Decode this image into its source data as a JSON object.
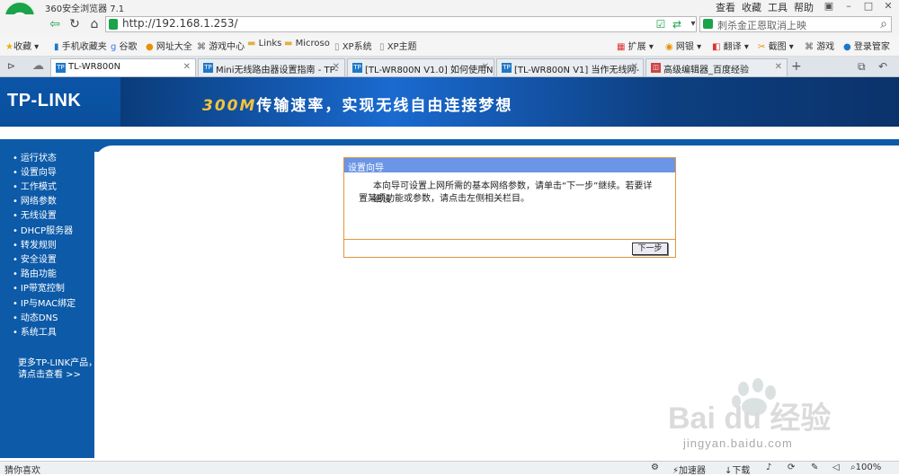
{
  "window": {
    "title": "360安全浏览器 7.1",
    "menu": [
      "查看",
      "收藏",
      "工具",
      "帮助"
    ]
  },
  "addressbar": {
    "url": "http://192.168.1.253/",
    "search_placeholder": "刺杀金正恩取消上映"
  },
  "bookmarks": [
    "收藏",
    "手机收藏夹",
    "谷歌",
    "网址大全",
    "游戏中心",
    "Links",
    "Microso",
    "XP系统",
    "XP主题"
  ],
  "toolbar_right": [
    "扩展",
    "网银",
    "翻译",
    "截图",
    "游戏",
    "登录管家"
  ],
  "tabs": [
    {
      "label": "TL-WR800N",
      "active": true
    },
    {
      "label": "Mini无线路由器设置指南 - TP-",
      "active": false
    },
    {
      "label": "[TL-WR800N V1.0] 如何使用N",
      "active": false
    },
    {
      "label": "[TL-WR800N V1] 当作无线网-",
      "active": false
    },
    {
      "label": "高级编辑器_百度经验",
      "active": false
    }
  ],
  "banner": {
    "brand": "TP-LINK",
    "slogan_em": "300M",
    "slogan_rest": "传输速率，实现无线自由连接梦想"
  },
  "leftnav": {
    "items": [
      "运行状态",
      "设置向导",
      "工作模式",
      "网络参数",
      "无线设置",
      "DHCP服务器",
      "转发规则",
      "安全设置",
      "路由功能",
      "IP带宽控制",
      "IP与MAC绑定",
      "动态DNS",
      "系统工具"
    ],
    "more_line1": "更多TP-LINK产品，",
    "more_line2": "请点击查看 >>"
  },
  "dialog": {
    "title": "设置向导",
    "text_line1": "本向导可设置上网所需的基本网络参数，请单击“下一步”继续。若要详细设",
    "text_line2": "置某项功能或参数，请点击左侧相关栏目。",
    "next_label": "下一步"
  },
  "statusbar": {
    "left": "猜你喜欢",
    "accelerator": "加速器",
    "download": "下载",
    "zoom": "100%"
  },
  "watermark": {
    "text": "Bai du 经验",
    "url": "jingyan.baidu.com"
  },
  "colors": {
    "nav_blue": "#0c5aa8",
    "dialog_header": "#6b95e6",
    "dialog_border": "#e09540",
    "brand_green": "#1aa34a"
  }
}
